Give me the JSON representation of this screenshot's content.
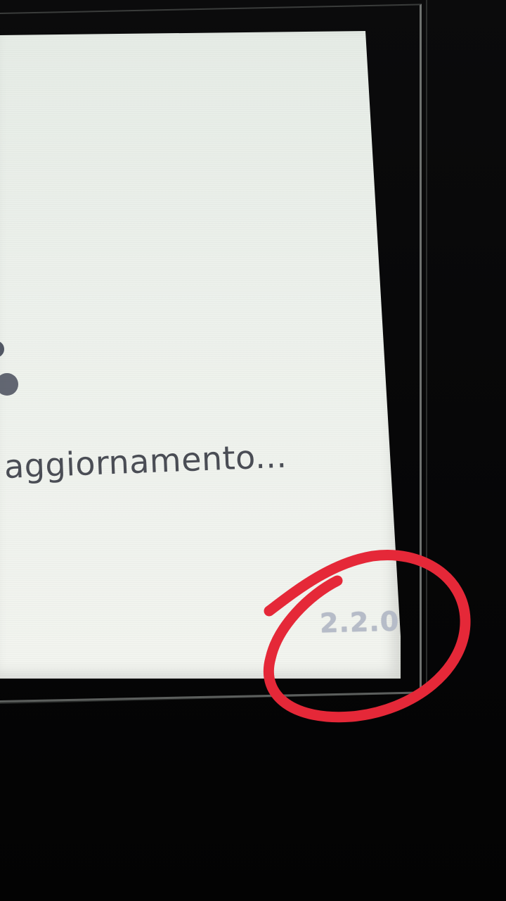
{
  "screen": {
    "status_text": "aggiornamento...",
    "version_label": "2.2.0"
  },
  "spinner": {
    "icon": "loading-spinner-icon",
    "color": "#525764"
  },
  "annotation": {
    "shape": "hand-drawn-circle",
    "color": "#e52838"
  },
  "colors": {
    "screen_background": "#edf1ec",
    "text": "#4a4d55",
    "version_text": "#b6bcc8"
  }
}
